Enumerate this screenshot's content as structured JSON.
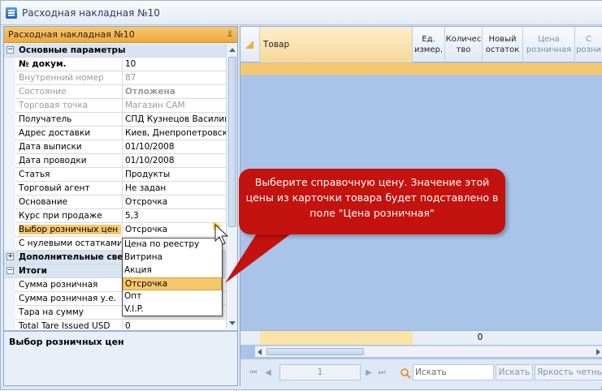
{
  "window": {
    "title": "Расходная накладная №10"
  },
  "panel": {
    "title": "Расходная накладная №10",
    "pin_glyph": "ꟸ",
    "description": "Выбор розничных цен"
  },
  "properties": [
    {
      "type": "category",
      "toggle": "−",
      "label": "Основные параметры"
    },
    {
      "label": "№ докум.",
      "value": "10",
      "bold": true
    },
    {
      "label": "Внутренний номер",
      "value": "87",
      "dim": true
    },
    {
      "label": "Состояние",
      "value": "Отложена",
      "dim": true,
      "value_bold": true
    },
    {
      "label": "Торговая точка",
      "value": "Магазин САМ",
      "dim": true
    },
    {
      "label": "Получатель",
      "value": "СПД Кузнецов Василий"
    },
    {
      "label": "Адрес доставки",
      "value": "Киев, Днепропетровска"
    },
    {
      "label": "Дата выписки",
      "value": "01/10/2008"
    },
    {
      "label": "Дата проводки",
      "value": "01/10/2008"
    },
    {
      "label": "Статья",
      "value": "Продукты"
    },
    {
      "label": "Торговый агент",
      "value": "Не задан"
    },
    {
      "label": "Основание",
      "value": " Отсрочка"
    },
    {
      "label": "Курс при продаже",
      "value": "5,3"
    },
    {
      "label": "Выбор розничных цен",
      "value": "Отсрочка",
      "selected": true
    },
    {
      "label": "С нулевыми остатками",
      "value": ""
    },
    {
      "type": "category",
      "toggle": "+",
      "label": "Дополнительные сведения"
    },
    {
      "type": "category",
      "toggle": "−",
      "label": "Итоги"
    },
    {
      "label": "Сумма розничная",
      "value": ""
    },
    {
      "label": "Сумма розничная у.е.",
      "value": ""
    },
    {
      "label": "Тара на сумму",
      "value": ""
    },
    {
      "label": "Total Tare Issued USD",
      "value": "0"
    }
  ],
  "dropdown": {
    "options": [
      "Цена по реестру",
      "Витрина",
      "Акция",
      "Отсрочка",
      "Опт",
      "V.I.P."
    ],
    "selected": "Отсрочка"
  },
  "grid": {
    "columns": [
      {
        "label": "Товар"
      },
      {
        "label": "Ед.\nизмер."
      },
      {
        "label": "Количес\nтво"
      },
      {
        "label": "Новый\nостаток"
      },
      {
        "label": "Цена\nрозничная"
      },
      {
        "label": "С\nрозни"
      }
    ],
    "summary_value": "0"
  },
  "navigator": {
    "page": "1",
    "search_placeholder": "Искать",
    "search_button": "Искать",
    "brightness_label": "Яркость четных строк"
  },
  "callout": {
    "text": "Выберите справочную цену. Значение этой цены из карточки товара будет подставлено в поле \"Цена розничная\""
  },
  "colors": {
    "accent_orange": "#f6c96d",
    "callout_red": "#c4120f",
    "grid_blue": "#a9c4e8"
  }
}
